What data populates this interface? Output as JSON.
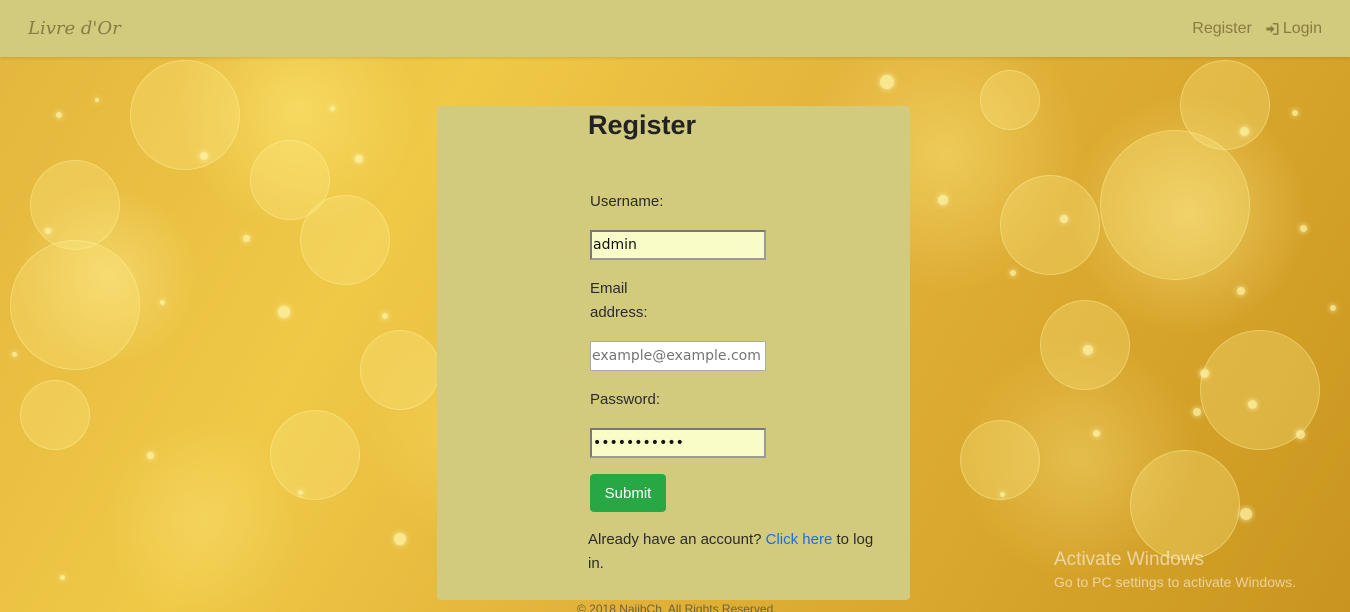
{
  "nav": {
    "brand": "Livre d'Or",
    "register_label": "Register",
    "login_label": "Login",
    "login_icon": "sign-in-icon"
  },
  "form": {
    "title": "Register",
    "username_label": "Username:",
    "username_value": "admin",
    "email_label_line1": "Email",
    "email_label_line2": "address:",
    "email_placeholder": "example@example.com",
    "password_label": "Password:",
    "password_value": "•••••••••••",
    "submit_label": "Submit",
    "login_prompt_prefix": "Already have an account?",
    "login_link_label": "Click here",
    "login_prompt_suffix": "to log in."
  },
  "footer": {
    "copyright": "© 2018 NajibCh. All Rights Reserved."
  },
  "overlay": {
    "activate_title": "Activate Windows",
    "activate_subtitle": "Go to PC settings to activate Windows."
  },
  "colors": {
    "navbar": "#d2ca7c",
    "card": "#d2ca7c",
    "submit": "#28a745",
    "link": "#1a6fe0",
    "brand_text": "#8a7b45"
  }
}
